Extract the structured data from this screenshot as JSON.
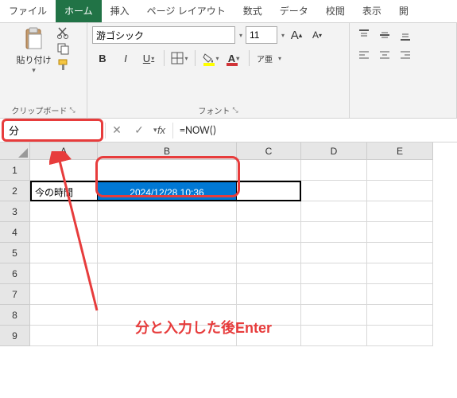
{
  "tabs": {
    "file": "ファイル",
    "home": "ホーム",
    "insert": "挿入",
    "layout": "ページ レイアウト",
    "formulas": "数式",
    "data": "データ",
    "review": "校閲",
    "view": "表示",
    "open": "開"
  },
  "ribbon": {
    "clipboard": {
      "paste": "貼り付け",
      "label": "クリップボード"
    },
    "font": {
      "name": "游ゴシック",
      "size": "11",
      "increase": "A",
      "decrease": "A",
      "bold": "B",
      "italic": "I",
      "underline": "U",
      "fill": "A",
      "color": "A",
      "ruby": "ア亜",
      "label": "フォント"
    }
  },
  "namebox": "分",
  "formula": "=NOW()",
  "columns": {
    "A": "A",
    "B": "B",
    "C": "C",
    "D": "D",
    "E": "E"
  },
  "rows": [
    "1",
    "2",
    "3",
    "4",
    "5",
    "6",
    "7",
    "8",
    "9"
  ],
  "cells": {
    "A2": "今の時間",
    "B2": "2024/12/28 10:36"
  },
  "annotation": "分と入力した後Enter"
}
